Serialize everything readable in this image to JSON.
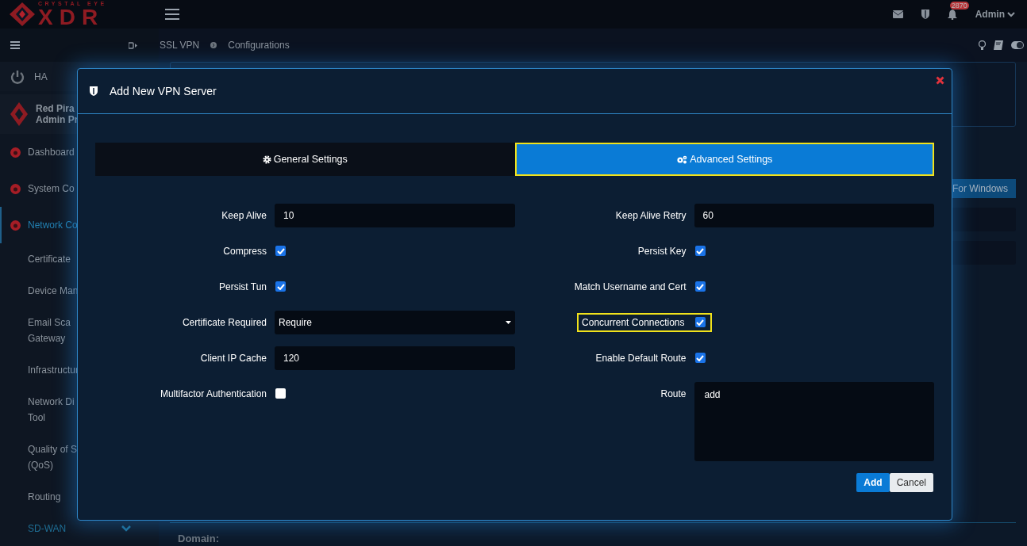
{
  "header": {
    "logo_top": "CRYSTAL EYE",
    "logo_main": "XDR",
    "notifications": "2870",
    "user": "Admin"
  },
  "sidebar": {
    "ha": "HA",
    "profile": [
      "Red Pira",
      "Admin Pr"
    ],
    "items": [
      {
        "label": "Dashboard",
        "selected": false
      },
      {
        "label": "System Co",
        "selected": false
      },
      {
        "label": "Network Co",
        "selected": true,
        "children": [
          {
            "label": "Certificate",
            "kind": "link",
            "selected": false
          },
          {
            "label": "Device Man",
            "kind": "group",
            "selected": false,
            "expanded": false
          },
          {
            "label": "Email Sca\nGateway",
            "kind": "link",
            "selected": false
          },
          {
            "label": "Infrastructur",
            "kind": "group",
            "selected": false,
            "expanded": false
          },
          {
            "label": "Network Di\nTool",
            "kind": "link",
            "selected": false
          },
          {
            "label": "Quality of S\n(QoS)",
            "kind": "link",
            "selected": false
          },
          {
            "label": "Routing",
            "kind": "group",
            "selected": false,
            "expanded": false
          },
          {
            "label": "SD-WAN",
            "kind": "group",
            "selected": false,
            "expanded": true
          }
        ]
      }
    ]
  },
  "breadcrumb": [
    "SSL VPN",
    "Configurations"
  ],
  "background": {
    "button": "For Windows",
    "footer_label": "Domain:"
  },
  "modal": {
    "title": "Add New VPN Server",
    "tabs": [
      {
        "label": "General Settings",
        "selected": false,
        "highlighted": false
      },
      {
        "label": "Advanced Settings",
        "selected": true,
        "highlighted": true
      }
    ],
    "rows": [
      [
        {
          "label": "Keep Alive",
          "kind": "text",
          "value": "10",
          "highlighted": false
        },
        {
          "label": "Keep Alive Retry",
          "kind": "text",
          "value": "60",
          "highlighted": false
        }
      ],
      [
        {
          "label": "Compress",
          "kind": "checkbox",
          "checked": true,
          "highlighted": false
        },
        {
          "label": "Persist Key",
          "kind": "checkbox",
          "checked": true,
          "highlighted": false
        }
      ],
      [
        {
          "label": "Persist Tun",
          "kind": "checkbox",
          "checked": true,
          "highlighted": false
        },
        {
          "label": "Match Username and Cert",
          "kind": "checkbox",
          "checked": true,
          "highlighted": false
        }
      ],
      [
        {
          "label": "Certificate Required",
          "kind": "select",
          "value": "Require",
          "highlighted": false
        },
        {
          "label": "Concurrent Connections",
          "kind": "checkbox",
          "checked": true,
          "highlighted": true
        }
      ],
      [
        {
          "label": "Client IP Cache",
          "kind": "text",
          "value": "120",
          "highlighted": false
        },
        {
          "label": "Enable Default Route",
          "kind": "checkbox",
          "checked": true,
          "highlighted": false
        }
      ],
      [
        {
          "label": "Multifactor Authentication",
          "kind": "checkbox",
          "checked": false,
          "highlighted": false
        },
        {
          "label": "Route",
          "kind": "textarea",
          "value": "add",
          "highlighted": false
        }
      ]
    ],
    "buttons": [
      {
        "label": "Add",
        "kind": "primary"
      },
      {
        "label": "Cancel",
        "kind": "secondary"
      }
    ]
  }
}
